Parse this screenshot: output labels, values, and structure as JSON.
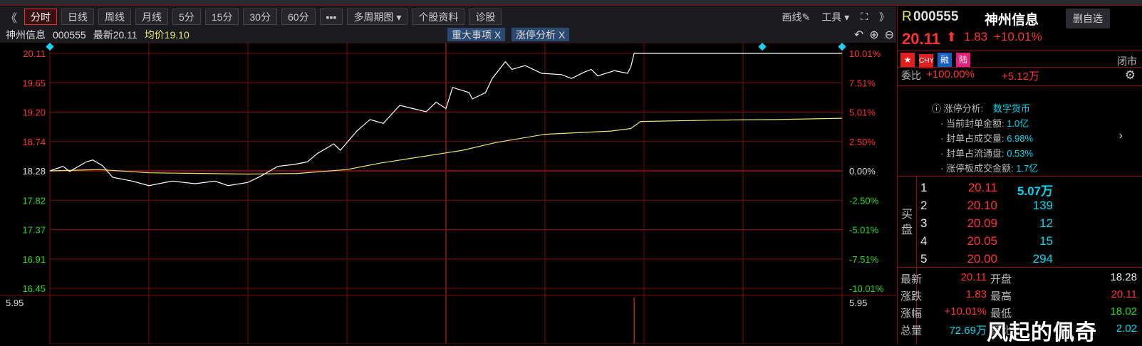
{
  "toolbar": {
    "back": "《",
    "tabs": [
      "分时",
      "日线",
      "周线",
      "月线",
      "5分",
      "15分",
      "30分",
      "60分",
      "▪▪▪",
      "多周期图 ▾",
      "个股资料",
      "诊股"
    ],
    "draw": "画线",
    "tools": "工具 ▾",
    "forward": "》"
  },
  "info": {
    "name": "神州信息",
    "code": "000555",
    "latest": "最新20.11",
    "avg": "均价19.10",
    "tags": [
      "重大事项 X",
      "涨停分析 X"
    ]
  },
  "axis": {
    "left": [
      "20.11",
      "19.65",
      "19.20",
      "18.74",
      "18.28",
      "17.82",
      "17.37",
      "16.91",
      "16.45"
    ],
    "right": [
      "10.01%",
      "7.51%",
      "5.01%",
      "2.50%",
      "0.00%",
      "-2.50%",
      "-5.01%",
      "-7.51%",
      "-10.01%"
    ],
    "vol_left": "5.95",
    "vol_right": "5.95"
  },
  "chart_data": {
    "type": "line",
    "prev_close": 18.28,
    "ylim": [
      16.45,
      20.11
    ],
    "x_minutes": [
      0,
      240
    ],
    "price": [
      [
        0,
        18.28
      ],
      [
        4,
        18.35
      ],
      [
        6,
        18.27
      ],
      [
        11,
        18.42
      ],
      [
        13,
        18.45
      ],
      [
        16,
        18.36
      ],
      [
        19,
        18.18
      ],
      [
        25,
        18.12
      ],
      [
        30,
        18.05
      ],
      [
        37,
        18.12
      ],
      [
        44,
        18.08
      ],
      [
        50,
        18.12
      ],
      [
        54,
        18.05
      ],
      [
        60,
        18.1
      ],
      [
        64,
        18.2
      ],
      [
        69,
        18.35
      ],
      [
        74,
        18.38
      ],
      [
        78,
        18.42
      ],
      [
        81,
        18.55
      ],
      [
        86,
        18.7
      ],
      [
        88,
        18.6
      ],
      [
        93,
        18.9
      ],
      [
        97,
        19.08
      ],
      [
        101,
        19.02
      ],
      [
        106,
        19.3
      ],
      [
        110,
        19.25
      ],
      [
        114,
        19.2
      ],
      [
        117,
        19.35
      ],
      [
        120,
        19.25
      ],
      [
        122,
        19.58
      ],
      [
        127,
        19.5
      ],
      [
        128,
        19.4
      ],
      [
        132,
        19.5
      ],
      [
        134,
        19.72
      ],
      [
        138,
        19.98
      ],
      [
        140,
        19.86
      ],
      [
        144,
        19.92
      ],
      [
        149,
        19.8
      ],
      [
        155,
        19.78
      ],
      [
        158,
        19.72
      ],
      [
        162,
        19.82
      ],
      [
        164,
        19.86
      ],
      [
        166,
        19.76
      ],
      [
        171,
        19.84
      ],
      [
        175,
        19.8
      ],
      [
        176,
        19.9
      ],
      [
        177,
        20.11
      ],
      [
        240,
        20.11
      ]
    ],
    "avg": [
      [
        0,
        18.28
      ],
      [
        15,
        18.3
      ],
      [
        30,
        18.25
      ],
      [
        60,
        18.23
      ],
      [
        75,
        18.24
      ],
      [
        90,
        18.3
      ],
      [
        100,
        18.4
      ],
      [
        115,
        18.52
      ],
      [
        125,
        18.6
      ],
      [
        135,
        18.72
      ],
      [
        150,
        18.85
      ],
      [
        170,
        18.9
      ],
      [
        176,
        18.94
      ],
      [
        179,
        19.05
      ],
      [
        200,
        19.07
      ],
      [
        220,
        19.08
      ],
      [
        240,
        19.1
      ]
    ]
  },
  "right": {
    "r": "R",
    "code": "000555",
    "name": "神州信息",
    "del": "删自选",
    "price": "20.11",
    "change": "1.83",
    "pct": "+10.01%",
    "cny": "CHY",
    "rong": "融",
    "lu": "陆",
    "closed": "闭市",
    "wb_label": "委比",
    "wb_pct": "+100.00%",
    "wb_val": "+5.12万",
    "zt": {
      "title": "涨停分析:",
      "concept": "数字货币",
      "items": [
        [
          "· 当前封单金额:",
          "1.0亿"
        ],
        [
          "· 封单占成交量:",
          "6.98%"
        ],
        [
          "· 封单占流通盘:",
          "0.53%"
        ],
        [
          "· 涨停板成交金额:",
          "1.7亿"
        ]
      ]
    },
    "buy_label": "买盘",
    "bids": [
      [
        "1",
        "20.11",
        "5.07万"
      ],
      [
        "2",
        "20.10",
        "139"
      ],
      [
        "3",
        "20.09",
        "12"
      ],
      [
        "4",
        "20.05",
        "15"
      ],
      [
        "5",
        "20.00",
        "294"
      ]
    ],
    "stats": [
      [
        "最新",
        "20.11",
        "开盘",
        "18.28"
      ],
      [
        "涨跌",
        "1.83",
        "最高",
        "20.11"
      ],
      [
        "涨幅",
        "+10.01%",
        "最低",
        "18.02"
      ],
      [
        "总量",
        "72.69万",
        "量比",
        "2.02"
      ]
    ]
  },
  "watermark": "风起的佩奇",
  "colors": {
    "up": "#ff3232",
    "down": "#22dd22",
    "price_line": "#ffffff",
    "avg_line": "#e8e870",
    "grid": "#7a0c0c"
  }
}
